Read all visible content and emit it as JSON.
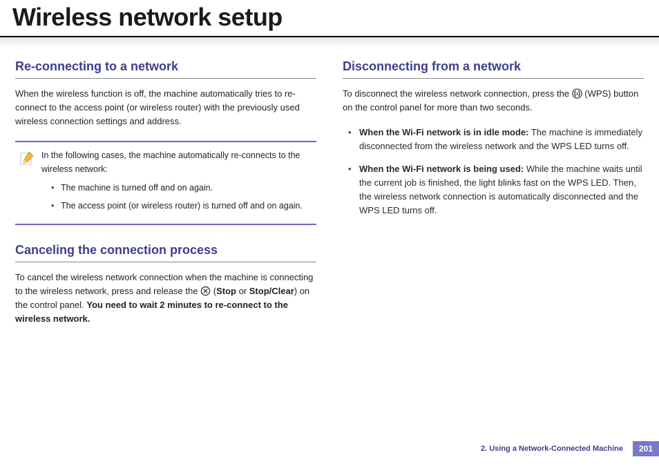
{
  "title": "Wireless network setup",
  "left": {
    "section1": {
      "heading": "Re-connecting to a network",
      "body": "When the wireless function is off, the machine automatically tries to re-connect to the access point (or wireless router) with the previously used wireless connection settings and address."
    },
    "note": {
      "intro": "In the following cases, the machine automatically re-connects to the wireless network:",
      "items": [
        "The machine is turned off and on again.",
        "The access point (or wireless router) is turned off and on again."
      ]
    },
    "section2": {
      "heading": "Canceling the connection process",
      "body_pre": "To cancel the wireless network connection when the machine is connecting to the wireless network, press and release the ",
      "body_mid1": " (",
      "stop": "Stop",
      "or": " or ",
      "stopclear": "Stop/Clear",
      "body_mid2": ") on the control panel. ",
      "bold_tail": "You need to wait 2 minutes to re-connect to the wireless network."
    }
  },
  "right": {
    "heading": "Disconnecting from a network",
    "body_pre": "To disconnect the wireless network connection, press the ",
    "body_post": " (WPS) button on the control panel for more than two seconds.",
    "items": [
      {
        "lead": "When the Wi-Fi network is in idle mode:",
        "rest": " The machine is immediately disconnected from the wireless network and the WPS LED turns off."
      },
      {
        "lead": "When the Wi-Fi network is being used:",
        "rest": " While the machine waits until the current job is finished, the light blinks fast on the WPS LED. Then, the wireless network connection is automatically disconnected and the WPS LED turns off."
      }
    ]
  },
  "footer": {
    "chapter": "2.  Using a Network-Connected Machine",
    "page": "201"
  }
}
